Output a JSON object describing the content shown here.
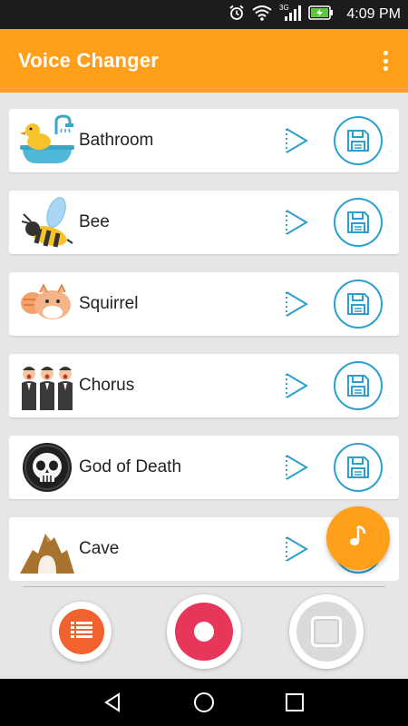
{
  "status_bar": {
    "time": "4:09 PM",
    "network_label": "3G",
    "icons": [
      "alarm-icon",
      "wifi-icon",
      "signal-icon",
      "battery-charging-icon"
    ]
  },
  "app_bar": {
    "title": "Voice Changer",
    "menu_icon": "overflow-menu-icon"
  },
  "colors": {
    "accent": "#ff9f1a",
    "icon_blue": "#2a9fd0",
    "record_red": "#e8365a",
    "list_orange": "#f2622e"
  },
  "effects": [
    {
      "label": "Bathroom",
      "icon": "bathtub-duck-icon"
    },
    {
      "label": "Bee",
      "icon": "bee-icon"
    },
    {
      "label": "Squirrel",
      "icon": "squirrel-icon"
    },
    {
      "label": "Chorus",
      "icon": "chorus-singers-icon"
    },
    {
      "label": "God of Death",
      "icon": "skull-icon"
    },
    {
      "label": "Cave",
      "icon": "cave-icon"
    }
  ],
  "fab": {
    "icon": "music-note-icon"
  },
  "bottom_controls": {
    "list_icon": "list-icon",
    "record_icon": "record-icon",
    "stop_icon": "stop-icon"
  },
  "nav_bar": {
    "icons": [
      "back-icon",
      "home-icon",
      "recents-icon"
    ]
  }
}
